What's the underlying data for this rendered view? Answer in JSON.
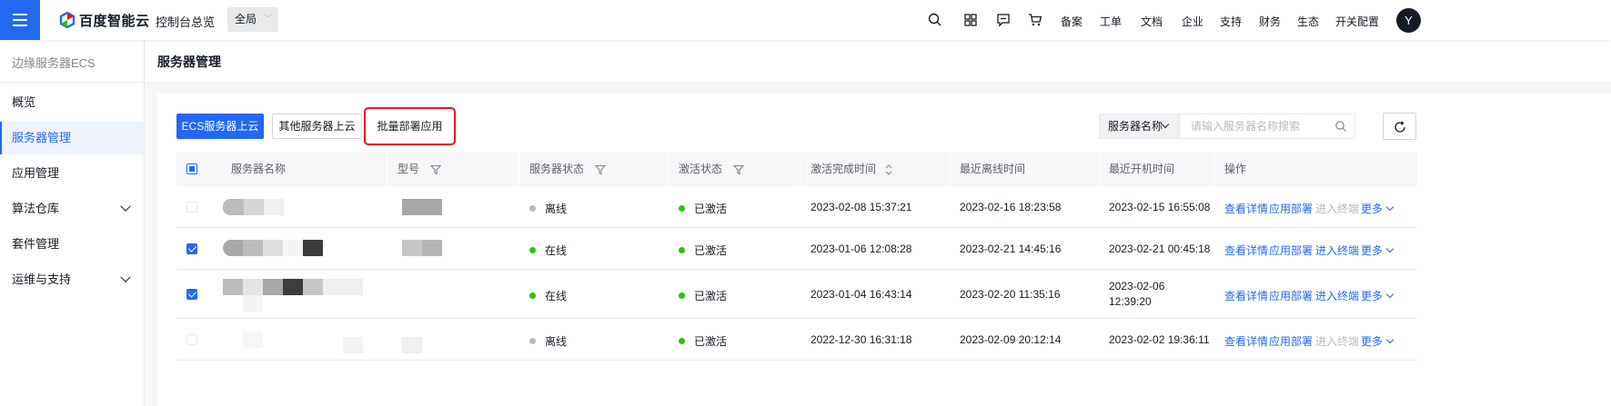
{
  "topbar": {
    "brand": "百度智能云",
    "console": "控制台总览",
    "region": "全局",
    "icons": [
      "search-icon",
      "apps-grid-icon",
      "message-icon",
      "cart-icon"
    ],
    "links": [
      "备案",
      "工单",
      "文档",
      "企业",
      "支持",
      "财务",
      "生态",
      "开关配置"
    ],
    "avatar": "Y"
  },
  "sidebar": {
    "title": "边缘服务器ECS",
    "items": [
      {
        "label": "概览",
        "active": false,
        "expandable": false
      },
      {
        "label": "服务器管理",
        "active": true,
        "expandable": false
      },
      {
        "label": "应用管理",
        "active": false,
        "expandable": false
      },
      {
        "label": "算法仓库",
        "active": false,
        "expandable": true
      },
      {
        "label": "套件管理",
        "active": false,
        "expandable": false
      },
      {
        "label": "运维与支持",
        "active": false,
        "expandable": true
      }
    ]
  },
  "page": {
    "title": "服务器管理"
  },
  "toolbar": {
    "ecs_up": "ECS服务器上云",
    "other_up": "其他服务器上云",
    "batch_deploy": "批量部署应用",
    "search_field": "服务器名称",
    "search_placeholder": "请输入服务器名称搜索"
  },
  "table": {
    "columns": [
      "服务器名称",
      "型号",
      "服务器状态",
      "激活状态",
      "激活完成时间",
      "最近离线时间",
      "最近开机时间",
      "操作"
    ],
    "rows": [
      {
        "checked": false,
        "status": "离线",
        "status_color": "#b8babf",
        "activation": "已激活",
        "activated_at": "2023-02-08 15:37:21",
        "last_offline": "2023-02-16 18:23:58",
        "last_boot": "2023-02-15 16:55:08",
        "ops": [
          "查看详情",
          "应用部署",
          "进入终端",
          "更多"
        ],
        "terminal_enabled": false
      },
      {
        "checked": true,
        "status": "在线",
        "status_color": "#30bf13",
        "activation": "已激活",
        "activated_at": "2023-01-06 12:08:28",
        "last_offline": "2023-02-21 14:45:16",
        "last_boot": "2023-02-21 00:45:18",
        "ops": [
          "查看详情",
          "应用部署",
          "进入终端",
          "更多"
        ],
        "terminal_enabled": true
      },
      {
        "checked": true,
        "status": "在线",
        "status_color": "#30bf13",
        "activation": "已激活",
        "activated_at": "2023-01-04 16:43:14",
        "last_offline": "2023-02-20 11:35:16",
        "last_boot_date": "2023-02-06",
        "last_boot_time": "12:39:20",
        "ops": [
          "查看详情",
          "应用部署",
          "进入终端",
          "更多"
        ],
        "terminal_enabled": true
      },
      {
        "checked": false,
        "status": "离线",
        "status_color": "#b8babf",
        "activation": "已激活",
        "activated_at": "2022-12-30 16:31:18",
        "last_offline": "2023-02-09 20:12:14",
        "last_boot": "2023-02-02 19:36:11",
        "ops": [
          "查看详情",
          "应用部署",
          "进入终端",
          "更多"
        ],
        "terminal_enabled": false
      }
    ]
  }
}
